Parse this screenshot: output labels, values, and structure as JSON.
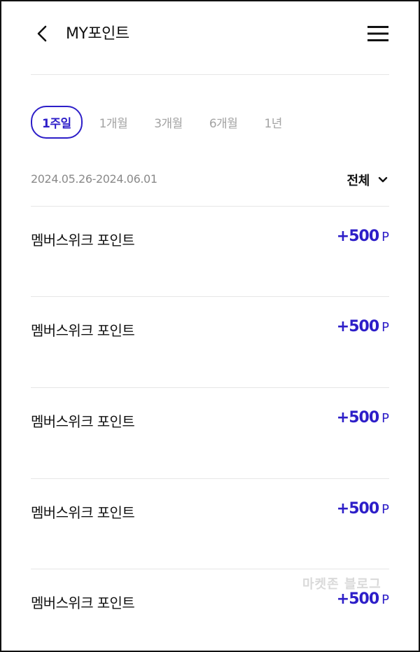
{
  "header": {
    "title": "MY포인트",
    "back_icon": "chevron-left-icon",
    "menu_icon": "hamburger-menu-icon"
  },
  "periods": [
    {
      "label": "1주일",
      "active": true
    },
    {
      "label": "1개월",
      "active": false
    },
    {
      "label": "3개월",
      "active": false
    },
    {
      "label": "6개월",
      "active": false
    },
    {
      "label": "1년",
      "active": false
    }
  ],
  "date_range": "2024.05.26-2024.06.01",
  "filter": {
    "label": "전체",
    "icon": "chevron-down-icon"
  },
  "points": [
    {
      "label": "멤버스위크 포인트",
      "amount": "+500",
      "unit": "P"
    },
    {
      "label": "멤버스위크 포인트",
      "amount": "+500",
      "unit": "P"
    },
    {
      "label": "멤버스위크 포인트",
      "amount": "+500",
      "unit": "P"
    },
    {
      "label": "멤버스위크 포인트",
      "amount": "+500",
      "unit": "P"
    },
    {
      "label": "멤버스위크 포인트",
      "amount": "+500",
      "unit": "P"
    }
  ],
  "watermark": "마켓존 블로그",
  "colors": {
    "accent": "#2d1ec8",
    "inactive_text": "#a3a3a3",
    "divider": "#e6e6e6",
    "date_text": "#8a8a8a"
  }
}
